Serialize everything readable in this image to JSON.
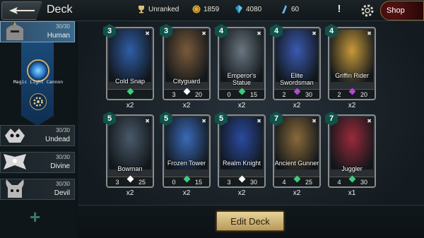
{
  "header": {
    "title": "Deck",
    "rank": "Unranked",
    "gold": "1859",
    "crystals": "4080",
    "shards": "60",
    "shop_label": "Shop"
  },
  "sidebar": {
    "factions": [
      {
        "name": "Human",
        "count": "30/30",
        "active": true
      },
      {
        "name": "Undead",
        "count": "30/30",
        "active": false
      },
      {
        "name": "Divine",
        "count": "30/30",
        "active": false
      },
      {
        "name": "Devil",
        "count": "30/30",
        "active": false
      }
    ],
    "hero_label": "Magic Light Cannon"
  },
  "cards": [
    {
      "name": "Cold Snap",
      "cost": "3",
      "atk": "",
      "hp": "",
      "qty": "x2",
      "gem": "#3ccf7a",
      "art": "#2f5ea8"
    },
    {
      "name": "Cityguard",
      "cost": "3",
      "atk": "3",
      "hp": "20",
      "qty": "x2",
      "gem": "#ffffff",
      "art": "#7a5a3a"
    },
    {
      "name": "Emperor's Statue",
      "cost": "4",
      "atk": "0",
      "hp": "15",
      "qty": "x2",
      "gem": "#3ccf7a",
      "art": "#6a7680"
    },
    {
      "name": "Elite Swordsman",
      "cost": "4",
      "atk": "2",
      "hp": "30",
      "qty": "x2",
      "gem": "#b04ad0",
      "art": "#3a5ab0"
    },
    {
      "name": "Griffin Rider",
      "cost": "4",
      "atk": "2",
      "hp": "20",
      "qty": "x2",
      "gem": "#b04ad0",
      "art": "#c89a3a"
    },
    {
      "name": "Bowman",
      "cost": "5",
      "atk": "3",
      "hp": "25",
      "qty": "x2",
      "gem": "#ffffff",
      "art": "#4a5a6a"
    },
    {
      "name": "Frozen Tower",
      "cost": "5",
      "atk": "0",
      "hp": "15",
      "qty": "x2",
      "gem": "#3ccf7a",
      "art": "#3a6ab8"
    },
    {
      "name": "Realm Knight",
      "cost": "5",
      "atk": "3",
      "hp": "30",
      "qty": "x2",
      "gem": "#ffffff",
      "art": "#2a4aa0"
    },
    {
      "name": "Ancient Gunner",
      "cost": "7",
      "atk": "4",
      "hp": "25",
      "qty": "x2",
      "gem": "#3ccf7a",
      "art": "#8a6a3a"
    },
    {
      "name": "Juggler",
      "cost": "7",
      "atk": "4",
      "hp": "30",
      "qty": "x1",
      "gem": "#3ccf7a",
      "art": "#9a2a3a"
    }
  ],
  "actions": {
    "edit_deck": "Edit Deck"
  }
}
